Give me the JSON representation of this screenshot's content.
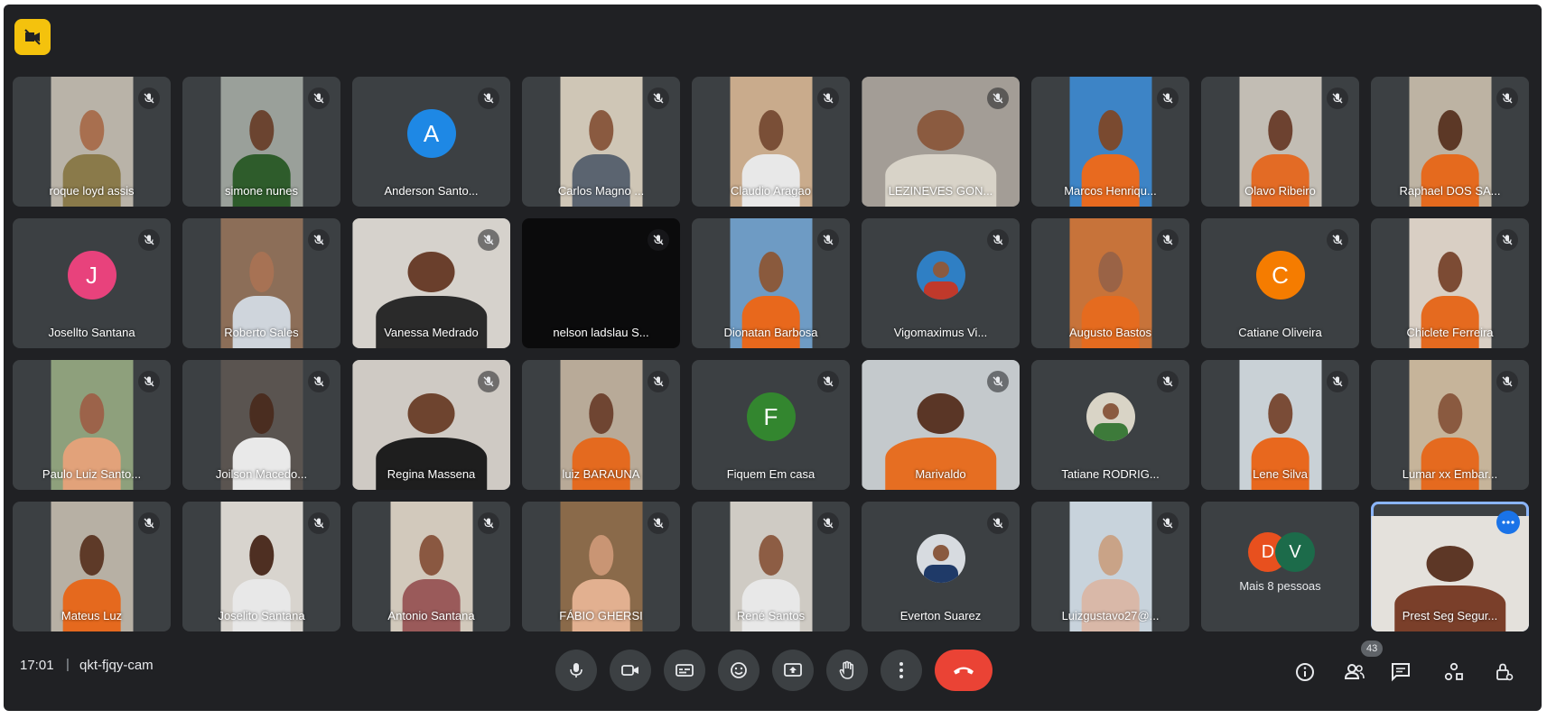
{
  "meeting": {
    "time": "17:01",
    "separator": "|",
    "code": "qkt-fjqy-cam"
  },
  "participants": [
    {
      "name": "roque loyd assis",
      "kind": "video",
      "muted": true,
      "bg": "#b9b3a8",
      "skin": "#a86f4f",
      "shirt": "#8a7a4a"
    },
    {
      "name": "simone nunes",
      "kind": "video",
      "muted": true,
      "bg": "#9aa09a",
      "skin": "#6b4430",
      "shirt": "#2e5c2b"
    },
    {
      "name": "Anderson Santo...",
      "kind": "avatar",
      "muted": true,
      "initial": "A",
      "color": "#1e88e5"
    },
    {
      "name": "Carlos Magno ...",
      "kind": "video",
      "muted": true,
      "bg": "#cfc6b6",
      "skin": "#8a5a40",
      "shirt": "#5b6470"
    },
    {
      "name": "Claudio Aragao",
      "kind": "video",
      "muted": true,
      "bg": "#c9ab8c",
      "skin": "#7a4f37",
      "shirt": "#e8e8e8"
    },
    {
      "name": "LEZINEVES GON...",
      "kind": "video-wide",
      "muted": true,
      "bg": "#a39d96",
      "skin": "#8b5b40",
      "shirt": "#d8d3c8"
    },
    {
      "name": "Marcos Henriqu...",
      "kind": "video",
      "muted": true,
      "bg": "#3d84c6",
      "skin": "#7a4a30",
      "shirt": "#e86a1f"
    },
    {
      "name": "Olavo Ribeiro",
      "kind": "video",
      "muted": true,
      "bg": "#c2bdb4",
      "skin": "#6d4230",
      "shirt": "#e36b25"
    },
    {
      "name": "Raphael DOS SA...",
      "kind": "video",
      "muted": true,
      "bg": "#bdb3a3",
      "skin": "#5c3826",
      "shirt": "#e56a1e"
    },
    {
      "name": "Josellto Santana",
      "kind": "avatar",
      "muted": true,
      "initial": "J",
      "color": "#e8427c"
    },
    {
      "name": "Roberto Sales",
      "kind": "video",
      "muted": true,
      "bg": "#8c6e58",
      "skin": "#a77254",
      "shirt": "#cfd5dc"
    },
    {
      "name": "Vanessa Medrado",
      "kind": "video-wide",
      "muted": true,
      "bg": "#d6d2cc",
      "skin": "#6a3f2c",
      "shirt": "#2a2a2a"
    },
    {
      "name": "nelson ladslau S...",
      "kind": "black",
      "muted": true
    },
    {
      "name": "Dionatan Barbosa",
      "kind": "video",
      "muted": true,
      "bg": "#6e9bc4",
      "skin": "#8a5a3d",
      "shirt": "#e8681c"
    },
    {
      "name": "Vigomaximus Vi...",
      "kind": "photo-avatar",
      "muted": true,
      "bg": "#2f7fc4",
      "accent": "#c0392b"
    },
    {
      "name": "Augusto Bastos",
      "kind": "video",
      "muted": true,
      "bg": "#c7733a",
      "skin": "#9a6346",
      "shirt": "#e56b1f"
    },
    {
      "name": "Catiane Oliveira",
      "kind": "avatar",
      "muted": true,
      "initial": "C",
      "color": "#f57c00"
    },
    {
      "name": "Chiclete Ferreira",
      "kind": "video",
      "muted": true,
      "bg": "#d9cfc4",
      "skin": "#7c4b34",
      "shirt": "#e56a1f"
    },
    {
      "name": "Paulo Luiz Santo...",
      "kind": "video",
      "muted": true,
      "bg": "#8ea07c",
      "skin": "#9c634a",
      "shirt": "#e2a27a"
    },
    {
      "name": "Joilson Macedo...",
      "kind": "video",
      "muted": true,
      "bg": "#5a5450",
      "skin": "#4a2d20",
      "shirt": "#e9e9e9"
    },
    {
      "name": "Regina Massena",
      "kind": "video-wide",
      "muted": true,
      "bg": "#cfcac4",
      "skin": "#6e442f",
      "shirt": "#1e1e1e"
    },
    {
      "name": "luiz BARAUNA",
      "kind": "video",
      "muted": true,
      "bg": "#b8aa98",
      "skin": "#6f4532",
      "shirt": "#e46a1f"
    },
    {
      "name": "Fiquem Em casa",
      "kind": "avatar",
      "muted": true,
      "initial": "F",
      "color": "#33862f"
    },
    {
      "name": "Marivaldo",
      "kind": "video-wide",
      "muted": true,
      "bg": "#c4c9cc",
      "skin": "#5a3626",
      "shirt": "#e66e22"
    },
    {
      "name": "Tatiane RODRIG...",
      "kind": "photo-avatar",
      "muted": true,
      "bg": "#d9d4c6",
      "accent": "#3d7a3a"
    },
    {
      "name": "Lene Silva",
      "kind": "video",
      "muted": true,
      "bg": "#c9d1d6",
      "skin": "#7a4c37",
      "shirt": "#e8681e"
    },
    {
      "name": "Lumar xx Embar...",
      "kind": "video",
      "muted": true,
      "bg": "#c6b49a",
      "skin": "#8a5a40",
      "shirt": "#e56a1f"
    },
    {
      "name": "Mateus Luz",
      "kind": "video",
      "muted": true,
      "bg": "#b7b0a4",
      "skin": "#5e3a28",
      "shirt": "#e5691e"
    },
    {
      "name": "Joselito Santana",
      "kind": "video",
      "muted": true,
      "bg": "#d8d4ce",
      "skin": "#4e2f22",
      "shirt": "#e8e8e8"
    },
    {
      "name": "Antonio Santana",
      "kind": "video",
      "muted": true,
      "bg": "#d2c9bc",
      "skin": "#8a5841",
      "shirt": "#9a5a5a"
    },
    {
      "name": "FÁBIO GHERSI",
      "kind": "video",
      "muted": true,
      "bg": "#8a6a4a",
      "skin": "#c99574",
      "shirt": "#e2b090"
    },
    {
      "name": "René Santos",
      "kind": "video",
      "muted": true,
      "bg": "#cfcbc4",
      "skin": "#8d5d44",
      "shirt": "#e8e8e8"
    },
    {
      "name": "Everton Suarez",
      "kind": "photo-avatar",
      "muted": true,
      "bg": "#d7dbe0",
      "accent": "#1f3a68"
    },
    {
      "name": "Luizgustavo27@...",
      "kind": "video",
      "muted": true,
      "bg": "#c8d3dc",
      "skin": "#c9a387",
      "shirt": "#d9b8a8"
    },
    {
      "name": "Mais 8 pessoas",
      "kind": "more",
      "muted": false,
      "initials": [
        {
          "letter": "D",
          "color": "#e8501e"
        },
        {
          "letter": "V",
          "color": "#1c6b4a"
        }
      ]
    },
    {
      "name": "Prest Seg Segur...",
      "kind": "self",
      "muted": false,
      "bg": "#e4e1dc",
      "skin": "#5d3726",
      "shirt": "#7a3f2a"
    }
  ],
  "controls": [
    {
      "id": "mic",
      "icon": "microphone-icon",
      "label": "Microphone"
    },
    {
      "id": "cam",
      "icon": "camera-icon",
      "label": "Camera"
    },
    {
      "id": "captions",
      "icon": "captions-icon",
      "label": "Captions"
    },
    {
      "id": "reactions",
      "icon": "emoji-icon",
      "label": "Reactions"
    },
    {
      "id": "present",
      "icon": "present-screen-icon",
      "label": "Present"
    },
    {
      "id": "hand",
      "icon": "raise-hand-icon",
      "label": "Raise hand"
    },
    {
      "id": "more",
      "icon": "more-options-icon",
      "label": "More options"
    },
    {
      "id": "end",
      "icon": "end-call-icon",
      "label": "Leave call"
    }
  ],
  "right_panel": {
    "people_count": "43",
    "icons": [
      "info-icon",
      "people-icon",
      "chat-icon",
      "activities-icon",
      "host-controls-icon"
    ]
  },
  "colors": {
    "background": "#202124",
    "tile": "#3c4043",
    "end_call": "#ea4335",
    "accent": "#8ab4f8"
  }
}
